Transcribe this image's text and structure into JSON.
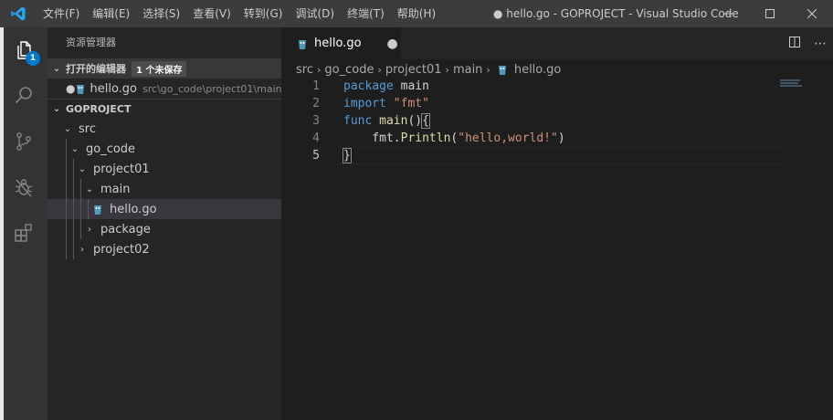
{
  "titlebar": {
    "menu": [
      "文件(F)",
      "编辑(E)",
      "选择(S)",
      "查看(V)",
      "转到(G)",
      "调试(D)",
      "终端(T)",
      "帮助(H)"
    ],
    "window_title": "● hello.go - GOPROJECT - Visual Studio Code",
    "controls": [
      "minimize-icon",
      "maximize-icon",
      "close-icon"
    ]
  },
  "activitybar": {
    "items": [
      "explorer-icon",
      "search-icon",
      "source-control-icon",
      "debug-icon",
      "extensions-icon"
    ],
    "explorer_badge": "1"
  },
  "sidebar": {
    "title": "资源管理器",
    "open_editors": {
      "header": "打开的编辑器",
      "unsaved_badge": "1 个未保存",
      "items": [
        {
          "name": "hello.go",
          "path": "src\\go_code\\project01\\main",
          "dirty": true
        }
      ]
    },
    "project": {
      "header": "GOPROJECT",
      "tree": [
        {
          "label": "src",
          "depth": 0,
          "expanded": true,
          "type": "folder"
        },
        {
          "label": "go_code",
          "depth": 1,
          "expanded": true,
          "type": "folder"
        },
        {
          "label": "project01",
          "depth": 2,
          "expanded": true,
          "type": "folder"
        },
        {
          "label": "main",
          "depth": 3,
          "expanded": true,
          "type": "folder"
        },
        {
          "label": "hello.go",
          "depth": 4,
          "expanded": false,
          "type": "file",
          "selected": true
        },
        {
          "label": "package",
          "depth": 3,
          "expanded": false,
          "type": "folder"
        },
        {
          "label": "project02",
          "depth": 2,
          "expanded": false,
          "type": "folder"
        }
      ]
    }
  },
  "editor": {
    "tab": {
      "label": "hello.go",
      "dirty_marker": "●"
    },
    "breadcrumb": [
      "src",
      "go_code",
      "project01",
      "main",
      "hello.go"
    ],
    "lines": [
      {
        "num": "1",
        "tokens": [
          {
            "t": "package",
            "c": "kw"
          },
          {
            "t": " main",
            "c": "plain-t"
          }
        ]
      },
      {
        "num": "2",
        "tokens": [
          {
            "t": "import",
            "c": "kw"
          },
          {
            "t": " ",
            "c": "plain-t"
          },
          {
            "t": "\"fmt\"",
            "c": "str"
          }
        ]
      },
      {
        "num": "3",
        "tokens": [
          {
            "t": "func",
            "c": "kw"
          },
          {
            "t": " ",
            "c": "plain-t"
          },
          {
            "t": "main",
            "c": "fn"
          },
          {
            "t": "()",
            "c": "plain-t"
          },
          {
            "t": "{",
            "c": "plain-t bracket-box"
          }
        ]
      },
      {
        "num": "4",
        "tokens": [
          {
            "t": "    fmt.",
            "c": "plain-t"
          },
          {
            "t": "Println",
            "c": "fn"
          },
          {
            "t": "(",
            "c": "plain-t"
          },
          {
            "t": "\"hello,world!\"",
            "c": "str"
          },
          {
            "t": ")",
            "c": "plain-t"
          }
        ]
      },
      {
        "num": "5",
        "tokens": [
          {
            "t": "}",
            "c": "plain-t bracket-box"
          }
        ]
      }
    ],
    "current_line": "5",
    "colors": {
      "keyword": "#569cd6",
      "string": "#ce9178",
      "function": "#dcdcaa",
      "accent": "#007acc"
    }
  }
}
